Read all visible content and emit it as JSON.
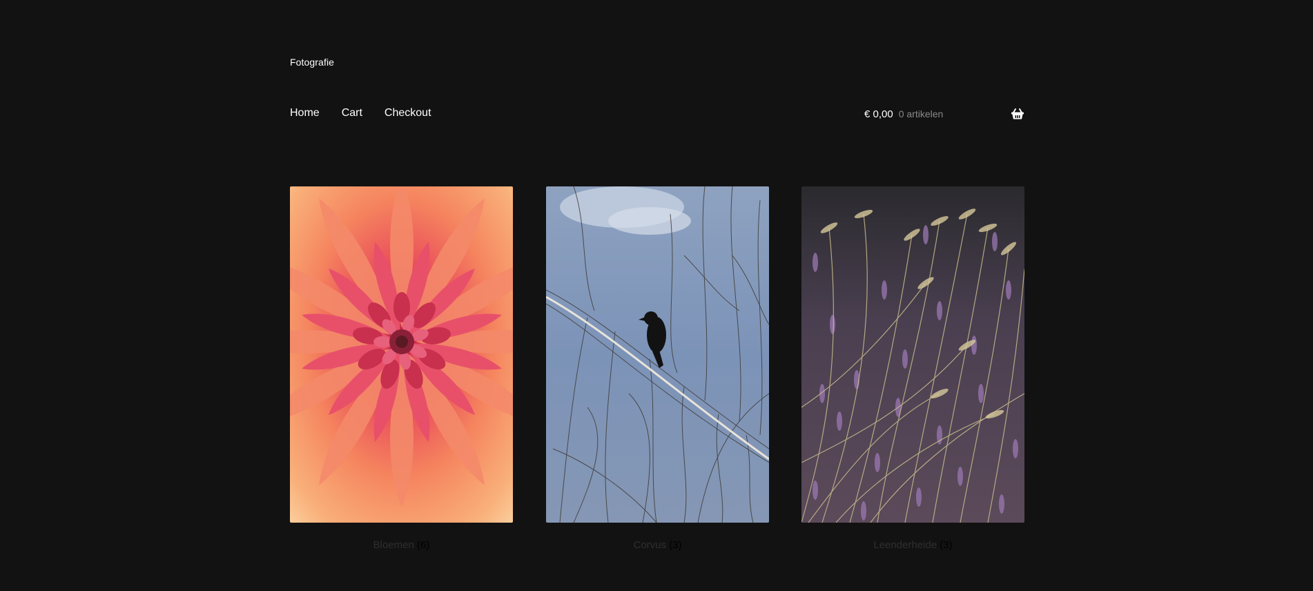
{
  "site": {
    "title": "Fotografie"
  },
  "nav": {
    "items": [
      {
        "label": "Home"
      },
      {
        "label": "Cart"
      },
      {
        "label": "Checkout"
      }
    ]
  },
  "cart": {
    "amount": "€ 0,00",
    "count_label": "0 artikelen",
    "icon": "basket-icon"
  },
  "categories": [
    {
      "name": "Bloemen",
      "count": "(6)",
      "image": "dahlia-flower-photo"
    },
    {
      "name": "Corvus",
      "count": "(3)",
      "image": "crow-in-tree-photo"
    },
    {
      "name": "Leenderheide",
      "count": "(3)",
      "image": "heather-grass-photo"
    }
  ],
  "colors": {
    "background": "#121212",
    "text": "#ffffff",
    "muted": "#8a8a8a"
  }
}
